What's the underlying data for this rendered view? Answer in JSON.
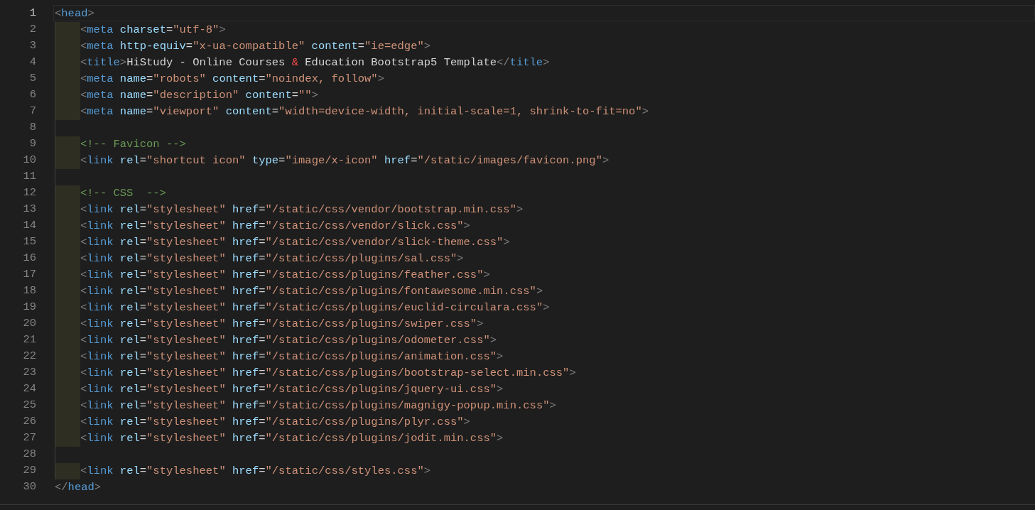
{
  "editor": {
    "lines": [
      {
        "number": "1",
        "current": true,
        "tokens": [
          {
            "kind": "punct",
            "text": "<"
          },
          {
            "kind": "tag",
            "text": "head"
          },
          {
            "kind": "punct",
            "text": ">"
          }
        ],
        "children": [
          {
            "number": "2",
            "current": false,
            "tokens": [
              {
                "kind": "punct",
                "text": "<"
              },
              {
                "kind": "tag",
                "text": "meta"
              },
              {
                "kind": "attr",
                "text": " charset"
              },
              {
                "kind": "plain",
                "text": "="
              },
              {
                "kind": "string",
                "text": "\"utf-8\""
              },
              {
                "kind": "punct",
                "text": ">"
              }
            ]
          },
          {
            "number": "3",
            "current": false,
            "tokens": [
              {
                "kind": "punct",
                "text": "<"
              },
              {
                "kind": "tag",
                "text": "meta"
              },
              {
                "kind": "attr",
                "text": " http-equiv"
              },
              {
                "kind": "plain",
                "text": "="
              },
              {
                "kind": "string",
                "text": "\"x-ua-compatible\""
              },
              {
                "kind": "attr",
                "text": " content"
              },
              {
                "kind": "plain",
                "text": "="
              },
              {
                "kind": "string",
                "text": "\"ie=edge\""
              },
              {
                "kind": "punct",
                "text": ">"
              }
            ]
          },
          {
            "number": "4",
            "current": false,
            "tokens": [
              {
                "kind": "punct",
                "text": "<"
              },
              {
                "kind": "tag",
                "text": "title"
              },
              {
                "kind": "punct",
                "text": ">"
              },
              {
                "kind": "plain",
                "text": "HiStudy - Online Courses "
              },
              {
                "kind": "entity",
                "text": "&"
              },
              {
                "kind": "plain",
                "text": " Education Bootstrap5 Template"
              },
              {
                "kind": "punct",
                "text": "</"
              },
              {
                "kind": "tag",
                "text": "title"
              },
              {
                "kind": "punct",
                "text": ">"
              }
            ]
          },
          {
            "number": "5",
            "current": false,
            "tokens": [
              {
                "kind": "punct",
                "text": "<"
              },
              {
                "kind": "tag",
                "text": "meta"
              },
              {
                "kind": "attr",
                "text": " name"
              },
              {
                "kind": "plain",
                "text": "="
              },
              {
                "kind": "string",
                "text": "\"robots\""
              },
              {
                "kind": "attr",
                "text": " content"
              },
              {
                "kind": "plain",
                "text": "="
              },
              {
                "kind": "string",
                "text": "\"noindex, follow\""
              },
              {
                "kind": "punct",
                "text": ">"
              }
            ]
          },
          {
            "number": "6",
            "current": false,
            "tokens": [
              {
                "kind": "punct",
                "text": "<"
              },
              {
                "kind": "tag",
                "text": "meta"
              },
              {
                "kind": "attr",
                "text": " name"
              },
              {
                "kind": "plain",
                "text": "="
              },
              {
                "kind": "string",
                "text": "\"description\""
              },
              {
                "kind": "attr",
                "text": " content"
              },
              {
                "kind": "plain",
                "text": "="
              },
              {
                "kind": "string",
                "text": "\"\""
              },
              {
                "kind": "punct",
                "text": ">"
              }
            ]
          },
          {
            "number": "7",
            "current": false,
            "tokens": [
              {
                "kind": "punct",
                "text": "<"
              },
              {
                "kind": "tag",
                "text": "meta"
              },
              {
                "kind": "attr",
                "text": " name"
              },
              {
                "kind": "plain",
                "text": "="
              },
              {
                "kind": "string",
                "text": "\"viewport\""
              },
              {
                "kind": "attr",
                "text": " content"
              },
              {
                "kind": "plain",
                "text": "="
              },
              {
                "kind": "string",
                "text": "\"width=device-width, initial-scale=1, shrink-to-fit=no\""
              },
              {
                "kind": "punct",
                "text": ">"
              }
            ]
          },
          {
            "number": "8",
            "current": false
          },
          {
            "number": "9",
            "current": false,
            "tokens": [
              {
                "kind": "comment",
                "text": "<!-- Favicon -->"
              }
            ]
          },
          {
            "number": "10",
            "current": false,
            "tokens": [
              {
                "kind": "punct",
                "text": "<"
              },
              {
                "kind": "tag",
                "text": "link"
              },
              {
                "kind": "attr",
                "text": " rel"
              },
              {
                "kind": "plain",
                "text": "="
              },
              {
                "kind": "string",
                "text": "\"shortcut icon\""
              },
              {
                "kind": "attr",
                "text": " type"
              },
              {
                "kind": "plain",
                "text": "="
              },
              {
                "kind": "string",
                "text": "\"image/x-icon\""
              },
              {
                "kind": "attr",
                "text": " href"
              },
              {
                "kind": "plain",
                "text": "="
              },
              {
                "kind": "string",
                "text": "\"/static/images/favicon.png\""
              },
              {
                "kind": "punct",
                "text": ">"
              }
            ]
          },
          {
            "number": "11",
            "current": false
          },
          {
            "number": "12",
            "current": false,
            "tokens": [
              {
                "kind": "comment",
                "text": "<!-- CSS  -->"
              }
            ]
          },
          {
            "number": "13",
            "current": false,
            "tokens": [
              {
                "kind": "punct",
                "text": "<"
              },
              {
                "kind": "tag",
                "text": "link"
              },
              {
                "kind": "attr",
                "text": " rel"
              },
              {
                "kind": "plain",
                "text": "="
              },
              {
                "kind": "string",
                "text": "\"stylesheet\""
              },
              {
                "kind": "attr",
                "text": " href"
              },
              {
                "kind": "plain",
                "text": "="
              },
              {
                "kind": "string",
                "text": "\"/static/css/vendor/bootstrap.min.css\""
              },
              {
                "kind": "punct",
                "text": ">"
              }
            ]
          },
          {
            "number": "14",
            "current": false,
            "tokens": [
              {
                "kind": "punct",
                "text": "<"
              },
              {
                "kind": "tag",
                "text": "link"
              },
              {
                "kind": "attr",
                "text": " rel"
              },
              {
                "kind": "plain",
                "text": "="
              },
              {
                "kind": "string",
                "text": "\"stylesheet\""
              },
              {
                "kind": "attr",
                "text": " href"
              },
              {
                "kind": "plain",
                "text": "="
              },
              {
                "kind": "string",
                "text": "\"/static/css/vendor/slick.css\""
              },
              {
                "kind": "punct",
                "text": ">"
              }
            ]
          },
          {
            "number": "15",
            "current": false,
            "tokens": [
              {
                "kind": "punct",
                "text": "<"
              },
              {
                "kind": "tag",
                "text": "link"
              },
              {
                "kind": "attr",
                "text": " rel"
              },
              {
                "kind": "plain",
                "text": "="
              },
              {
                "kind": "string",
                "text": "\"stylesheet\""
              },
              {
                "kind": "attr",
                "text": " href"
              },
              {
                "kind": "plain",
                "text": "="
              },
              {
                "kind": "string",
                "text": "\"/static/css/vendor/slick-theme.css\""
              },
              {
                "kind": "punct",
                "text": ">"
              }
            ]
          },
          {
            "number": "16",
            "current": false,
            "tokens": [
              {
                "kind": "punct",
                "text": "<"
              },
              {
                "kind": "tag",
                "text": "link"
              },
              {
                "kind": "attr",
                "text": " rel"
              },
              {
                "kind": "plain",
                "text": "="
              },
              {
                "kind": "string",
                "text": "\"stylesheet\""
              },
              {
                "kind": "attr",
                "text": " href"
              },
              {
                "kind": "plain",
                "text": "="
              },
              {
                "kind": "string",
                "text": "\"/static/css/plugins/sal.css\""
              },
              {
                "kind": "punct",
                "text": ">"
              }
            ]
          },
          {
            "number": "17",
            "current": false,
            "tokens": [
              {
                "kind": "punct",
                "text": "<"
              },
              {
                "kind": "tag",
                "text": "link"
              },
              {
                "kind": "attr",
                "text": " rel"
              },
              {
                "kind": "plain",
                "text": "="
              },
              {
                "kind": "string",
                "text": "\"stylesheet\""
              },
              {
                "kind": "attr",
                "text": " href"
              },
              {
                "kind": "plain",
                "text": "="
              },
              {
                "kind": "string",
                "text": "\"/static/css/plugins/feather.css\""
              },
              {
                "kind": "punct",
                "text": ">"
              }
            ]
          },
          {
            "number": "18",
            "current": false,
            "tokens": [
              {
                "kind": "punct",
                "text": "<"
              },
              {
                "kind": "tag",
                "text": "link"
              },
              {
                "kind": "attr",
                "text": " rel"
              },
              {
                "kind": "plain",
                "text": "="
              },
              {
                "kind": "string",
                "text": "\"stylesheet\""
              },
              {
                "kind": "attr",
                "text": " href"
              },
              {
                "kind": "plain",
                "text": "="
              },
              {
                "kind": "string",
                "text": "\"/static/css/plugins/fontawesome.min.css\""
              },
              {
                "kind": "punct",
                "text": ">"
              }
            ]
          },
          {
            "number": "19",
            "current": false,
            "tokens": [
              {
                "kind": "punct",
                "text": "<"
              },
              {
                "kind": "tag",
                "text": "link"
              },
              {
                "kind": "attr",
                "text": " rel"
              },
              {
                "kind": "plain",
                "text": "="
              },
              {
                "kind": "string",
                "text": "\"stylesheet\""
              },
              {
                "kind": "attr",
                "text": " href"
              },
              {
                "kind": "plain",
                "text": "="
              },
              {
                "kind": "string",
                "text": "\"/static/css/plugins/euclid-circulara.css\""
              },
              {
                "kind": "punct",
                "text": ">"
              }
            ]
          },
          {
            "number": "20",
            "current": false,
            "tokens": [
              {
                "kind": "punct",
                "text": "<"
              },
              {
                "kind": "tag",
                "text": "link"
              },
              {
                "kind": "attr",
                "text": " rel"
              },
              {
                "kind": "plain",
                "text": "="
              },
              {
                "kind": "string",
                "text": "\"stylesheet\""
              },
              {
                "kind": "attr",
                "text": " href"
              },
              {
                "kind": "plain",
                "text": "="
              },
              {
                "kind": "string",
                "text": "\"/static/css/plugins/swiper.css\""
              },
              {
                "kind": "punct",
                "text": ">"
              }
            ]
          },
          {
            "number": "21",
            "current": false,
            "tokens": [
              {
                "kind": "punct",
                "text": "<"
              },
              {
                "kind": "tag",
                "text": "link"
              },
              {
                "kind": "attr",
                "text": " rel"
              },
              {
                "kind": "plain",
                "text": "="
              },
              {
                "kind": "string",
                "text": "\"stylesheet\""
              },
              {
                "kind": "attr",
                "text": " href"
              },
              {
                "kind": "plain",
                "text": "="
              },
              {
                "kind": "string",
                "text": "\"/static/css/plugins/odometer.css\""
              },
              {
                "kind": "punct",
                "text": ">"
              }
            ]
          },
          {
            "number": "22",
            "current": false,
            "tokens": [
              {
                "kind": "punct",
                "text": "<"
              },
              {
                "kind": "tag",
                "text": "link"
              },
              {
                "kind": "attr",
                "text": " rel"
              },
              {
                "kind": "plain",
                "text": "="
              },
              {
                "kind": "string",
                "text": "\"stylesheet\""
              },
              {
                "kind": "attr",
                "text": " href"
              },
              {
                "kind": "plain",
                "text": "="
              },
              {
                "kind": "string",
                "text": "\"/static/css/plugins/animation.css\""
              },
              {
                "kind": "punct",
                "text": ">"
              }
            ]
          },
          {
            "number": "23",
            "current": false,
            "tokens": [
              {
                "kind": "punct",
                "text": "<"
              },
              {
                "kind": "tag",
                "text": "link"
              },
              {
                "kind": "attr",
                "text": " rel"
              },
              {
                "kind": "plain",
                "text": "="
              },
              {
                "kind": "string",
                "text": "\"stylesheet\""
              },
              {
                "kind": "attr",
                "text": " href"
              },
              {
                "kind": "plain",
                "text": "="
              },
              {
                "kind": "string",
                "text": "\"/static/css/plugins/bootstrap-select.min.css\""
              },
              {
                "kind": "punct",
                "text": ">"
              }
            ]
          },
          {
            "number": "24",
            "current": false,
            "tokens": [
              {
                "kind": "punct",
                "text": "<"
              },
              {
                "kind": "tag",
                "text": "link"
              },
              {
                "kind": "attr",
                "text": " rel"
              },
              {
                "kind": "plain",
                "text": "="
              },
              {
                "kind": "string",
                "text": "\"stylesheet\""
              },
              {
                "kind": "attr",
                "text": " href"
              },
              {
                "kind": "plain",
                "text": "="
              },
              {
                "kind": "string",
                "text": "\"/static/css/plugins/jquery-ui.css\""
              },
              {
                "kind": "punct",
                "text": ">"
              }
            ]
          },
          {
            "number": "25",
            "current": false,
            "tokens": [
              {
                "kind": "punct",
                "text": "<"
              },
              {
                "kind": "tag",
                "text": "link"
              },
              {
                "kind": "attr",
                "text": " rel"
              },
              {
                "kind": "plain",
                "text": "="
              },
              {
                "kind": "string",
                "text": "\"stylesheet\""
              },
              {
                "kind": "attr",
                "text": " href"
              },
              {
                "kind": "plain",
                "text": "="
              },
              {
                "kind": "string",
                "text": "\"/static/css/plugins/magnigy-popup.min.css\""
              },
              {
                "kind": "punct",
                "text": ">"
              }
            ]
          },
          {
            "number": "26",
            "current": false,
            "tokens": [
              {
                "kind": "punct",
                "text": "<"
              },
              {
                "kind": "tag",
                "text": "link"
              },
              {
                "kind": "attr",
                "text": " rel"
              },
              {
                "kind": "plain",
                "text": "="
              },
              {
                "kind": "string",
                "text": "\"stylesheet\""
              },
              {
                "kind": "attr",
                "text": " href"
              },
              {
                "kind": "plain",
                "text": "="
              },
              {
                "kind": "string",
                "text": "\"/static/css/plugins/plyr.css\""
              },
              {
                "kind": "punct",
                "text": ">"
              }
            ]
          },
          {
            "number": "27",
            "current": false,
            "tokens": [
              {
                "kind": "punct",
                "text": "<"
              },
              {
                "kind": "tag",
                "text": "link"
              },
              {
                "kind": "attr",
                "text": " rel"
              },
              {
                "kind": "plain",
                "text": "="
              },
              {
                "kind": "string",
                "text": "\"stylesheet\""
              },
              {
                "kind": "attr",
                "text": " href"
              },
              {
                "kind": "plain",
                "text": "="
              },
              {
                "kind": "string",
                "text": "\"/static/css/plugins/jodit.min.css\""
              },
              {
                "kind": "punct",
                "text": ">"
              }
            ]
          },
          {
            "number": "28",
            "current": false
          },
          {
            "number": "29",
            "current": false,
            "tokens": [
              {
                "kind": "punct",
                "text": "<"
              },
              {
                "kind": "tag",
                "text": "link"
              },
              {
                "kind": "attr",
                "text": " rel"
              },
              {
                "kind": "plain",
                "text": "="
              },
              {
                "kind": "string",
                "text": "\"stylesheet\""
              },
              {
                "kind": "attr",
                "text": " href"
              },
              {
                "kind": "plain",
                "text": "="
              },
              {
                "kind": "string",
                "text": "\"/static/css/styles.css\""
              },
              {
                "kind": "punct",
                "text": ">"
              }
            ]
          }
        ]
      },
      {
        "number": "30",
        "current": false,
        "tokens": [
          {
            "kind": "punct",
            "text": "</"
          },
          {
            "kind": "tag",
            "text": "head"
          },
          {
            "kind": "punct",
            "text": ">"
          }
        ]
      }
    ]
  }
}
